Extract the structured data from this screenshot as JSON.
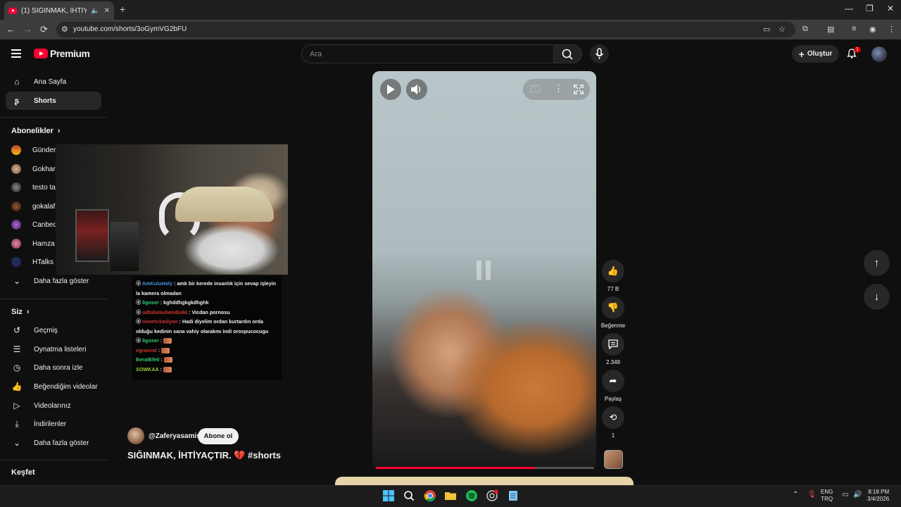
{
  "browser": {
    "tab_title": "(1) SIĞINMAK, İHTİYAÇTIR.",
    "url": "youtube.com/shorts/3oGymVG2bFU"
  },
  "header": {
    "logo_text": "Premium",
    "search_placeholder": "Ara",
    "create_label": "Oluştur",
    "notification_count": "1"
  },
  "sidebar": {
    "top_items": [
      {
        "label": "Ana Sayfa",
        "icon": "home-icon"
      },
      {
        "label": "Shorts",
        "icon": "shorts-icon"
      }
    ],
    "subscriptions_heading": "Abonelikler",
    "subscriptions": [
      {
        "label": "Günder"
      },
      {
        "label": "Gokhan"
      },
      {
        "label": "testo ta"
      },
      {
        "label": "gokalaf"
      },
      {
        "label": "Canbeq"
      },
      {
        "label": "Hamza"
      },
      {
        "label": "HTalks"
      }
    ],
    "show_more_subs": "Daha fazla göster",
    "you_heading": "Siz",
    "you_items": [
      {
        "label": "Geçmiş",
        "icon": "history-icon"
      },
      {
        "label": "Oynatma listeleri",
        "icon": "playlist-icon"
      },
      {
        "label": "Daha sonra izle",
        "icon": "clock-icon"
      },
      {
        "label": "Beğendiğim videolar",
        "icon": "thumbs-up-icon"
      },
      {
        "label": "Videolarınız",
        "icon": "video-icon"
      },
      {
        "label": "İndirilenler",
        "icon": "download-icon"
      }
    ],
    "show_more_you": "Daha fazla göster",
    "explore_heading": "Keşfet"
  },
  "chat": [
    {
      "user": "AmKuluHoly",
      "color": "#4a90e2",
      "text": "amk bir kerede insanlık için sevap işleyin la kamera olmadan"
    },
    {
      "user": "ligoser",
      "color": "#2ecc71",
      "text": "kghddhgkgkdhghk"
    },
    {
      "user": "odtulumuhendis66",
      "color": "#d0352f",
      "text": "Vicdan pornosu"
    },
    {
      "user": "nimetv1milyon",
      "color": "#d0352f",
      "text": "Hadi diyelim ordan kurtardın orda olduğu kedinin sana vahiy olarakmı indi orospucocugu"
    },
    {
      "user": "ligoser",
      "color": "#2ecc71",
      "text": ""
    },
    {
      "user": "egravcol",
      "color": "#d0352f",
      "text": ""
    },
    {
      "user": "BeratEfe0",
      "color": "#2ecc71",
      "text": ""
    },
    {
      "user": "SOWKAA",
      "color": "#9acd32",
      "text": ""
    }
  ],
  "video": {
    "progress_fraction": 0.73,
    "channel": "@Zaferyasamis",
    "subscribe_label": "Abone ol",
    "title": "SIĞINMAK, İHTİYAÇTIR. 💔 #shorts"
  },
  "actions": {
    "likes": "77 B",
    "dislike_label": "Beğenme",
    "comments": "2.349",
    "share_label": "Paylaş",
    "remix_count": "1"
  },
  "taskbar": {
    "lang_top": "ENG",
    "lang_bottom": "TRQ",
    "time": "8:18 PM",
    "date": "3/4/2026"
  }
}
